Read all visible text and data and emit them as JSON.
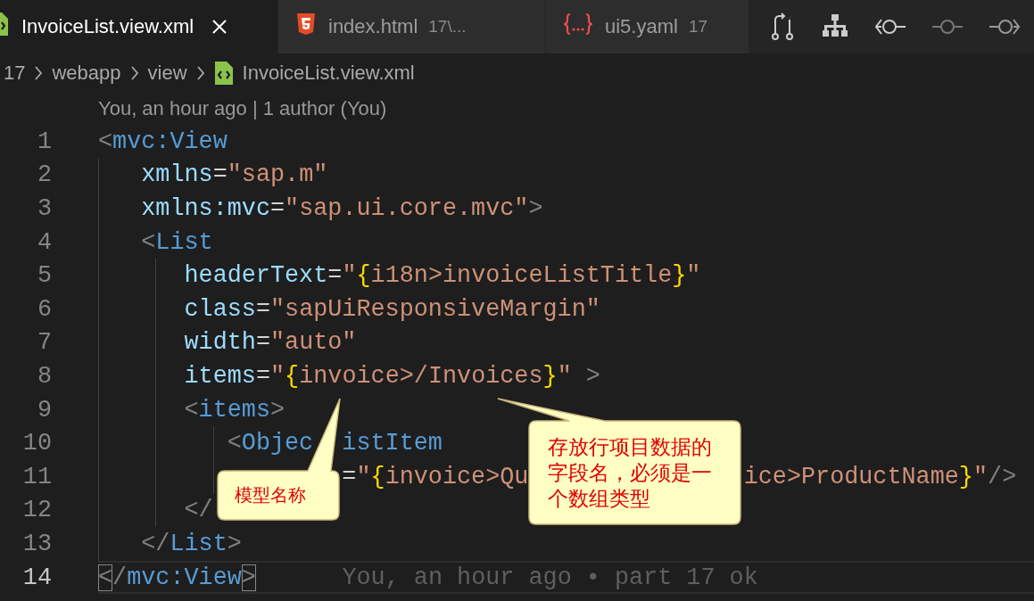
{
  "tabs": [
    {
      "kind": "xml",
      "label": "InvoiceList.view.xml",
      "selected": true
    },
    {
      "kind": "html",
      "label": "index.html",
      "description": "17\\...",
      "selected": false
    },
    {
      "kind": "yaml",
      "label": "ui5.yaml",
      "description": "17",
      "selected": false
    }
  ],
  "breadcrumb": [
    {
      "kind": "folder",
      "label": "17"
    },
    {
      "kind": "folder",
      "label": "webapp"
    },
    {
      "kind": "folder",
      "label": "view"
    },
    {
      "kind": "file",
      "label": "InvoiceList.view.xml"
    }
  ],
  "code_lens": "You, an hour ago | 1 author (You)",
  "lines": [
    {
      "number": "1",
      "current": false,
      "tokens": [
        {
          "kind": "bracket",
          "text": "<"
        },
        {
          "kind": "tag",
          "text": "mvc:View"
        }
      ]
    },
    {
      "number": "2",
      "current": false,
      "tokens": [
        {
          "kind": "attr",
          "text": "xmlns"
        },
        {
          "kind": "eq",
          "text": "="
        },
        {
          "kind": "str",
          "text": "\"sap.m\""
        }
      ]
    },
    {
      "number": "3",
      "current": false,
      "tokens": [
        {
          "kind": "attr",
          "text": "xmlns:mvc"
        },
        {
          "kind": "eq",
          "text": "="
        },
        {
          "kind": "str",
          "text": "\"sap.ui.core.mvc\""
        },
        {
          "kind": "bracket",
          "text": ">"
        }
      ]
    },
    {
      "number": "4",
      "current": false,
      "tokens": [
        {
          "kind": "bracket",
          "text": "<"
        },
        {
          "kind": "tag",
          "text": "List"
        }
      ]
    },
    {
      "number": "5",
      "current": false,
      "tokens": [
        {
          "kind": "attr",
          "text": "headerText"
        },
        {
          "kind": "eq",
          "text": "="
        },
        {
          "kind": "str",
          "text": "\""
        },
        {
          "kind": "brace",
          "text": "{"
        },
        {
          "kind": "str",
          "text": "i18n>invoiceListTitle"
        },
        {
          "kind": "brace",
          "text": "}"
        },
        {
          "kind": "str",
          "text": "\""
        }
      ]
    },
    {
      "number": "6",
      "current": false,
      "tokens": [
        {
          "kind": "attr",
          "text": "class"
        },
        {
          "kind": "eq",
          "text": "="
        },
        {
          "kind": "str",
          "text": "\"sapUiResponsiveMargin\""
        }
      ]
    },
    {
      "number": "7",
      "current": false,
      "tokens": [
        {
          "kind": "attr",
          "text": "width"
        },
        {
          "kind": "eq",
          "text": "="
        },
        {
          "kind": "str",
          "text": "\"auto\""
        }
      ]
    },
    {
      "number": "8",
      "current": false,
      "tokens": [
        {
          "kind": "attr",
          "text": "items"
        },
        {
          "kind": "eq",
          "text": "="
        },
        {
          "kind": "str",
          "text": "\""
        },
        {
          "kind": "brace",
          "text": "{"
        },
        {
          "kind": "str",
          "text": "invoice>/Invoices"
        },
        {
          "kind": "brace",
          "text": "}"
        },
        {
          "kind": "str",
          "text": "\""
        },
        {
          "kind": "bracket",
          "text": " >"
        }
      ]
    },
    {
      "number": "9",
      "current": false,
      "tokens": [
        {
          "kind": "bracket",
          "text": "<"
        },
        {
          "kind": "tag",
          "text": "items"
        },
        {
          "kind": "bracket",
          "text": ">"
        }
      ]
    },
    {
      "number": "10",
      "current": false,
      "tokens": [
        {
          "kind": "bracket",
          "text": "<"
        },
        {
          "kind": "tag",
          "text": "Objec"
        },
        {
          "kind": "covered"
        },
        {
          "kind": "tag",
          "text": "istItem"
        }
      ]
    },
    {
      "number": "11",
      "current": false,
      "tokens": [
        {
          "kind": "covered"
        },
        {
          "kind": "eq",
          "text": "="
        },
        {
          "kind": "str",
          "text": "\""
        },
        {
          "kind": "brace",
          "text": "{"
        },
        {
          "kind": "str",
          "text": "invoice>Qu"
        },
        {
          "kind": "covered"
        },
        {
          "kind": "str",
          "text": "ice>ProductName"
        },
        {
          "kind": "brace",
          "text": "}"
        },
        {
          "kind": "str",
          "text": "\""
        },
        {
          "kind": "bracket",
          "text": "/>"
        }
      ]
    },
    {
      "number": "12",
      "current": false,
      "tokens": [
        {
          "kind": "bracket",
          "text": "</"
        }
      ]
    },
    {
      "number": "13",
      "current": false,
      "tokens": [
        {
          "kind": "bracket",
          "text": "</"
        },
        {
          "kind": "tag",
          "text": "List"
        },
        {
          "kind": "bracket",
          "text": ">"
        }
      ]
    },
    {
      "number": "14",
      "current": true,
      "tokens": [
        {
          "kind": "bracket",
          "text": "<",
          "matched": true
        },
        {
          "kind": "bracket",
          "text": "/"
        },
        {
          "kind": "tag",
          "text": "mvc:View"
        },
        {
          "kind": "bracket",
          "text": ">",
          "matched": true
        }
      ],
      "blame": "You, an hour ago • part 17 ok"
    }
  ],
  "callouts": [
    {
      "text": "模型名称"
    },
    {
      "text": "存放行项目数据的字段名，必须是一个数组类型"
    }
  ]
}
